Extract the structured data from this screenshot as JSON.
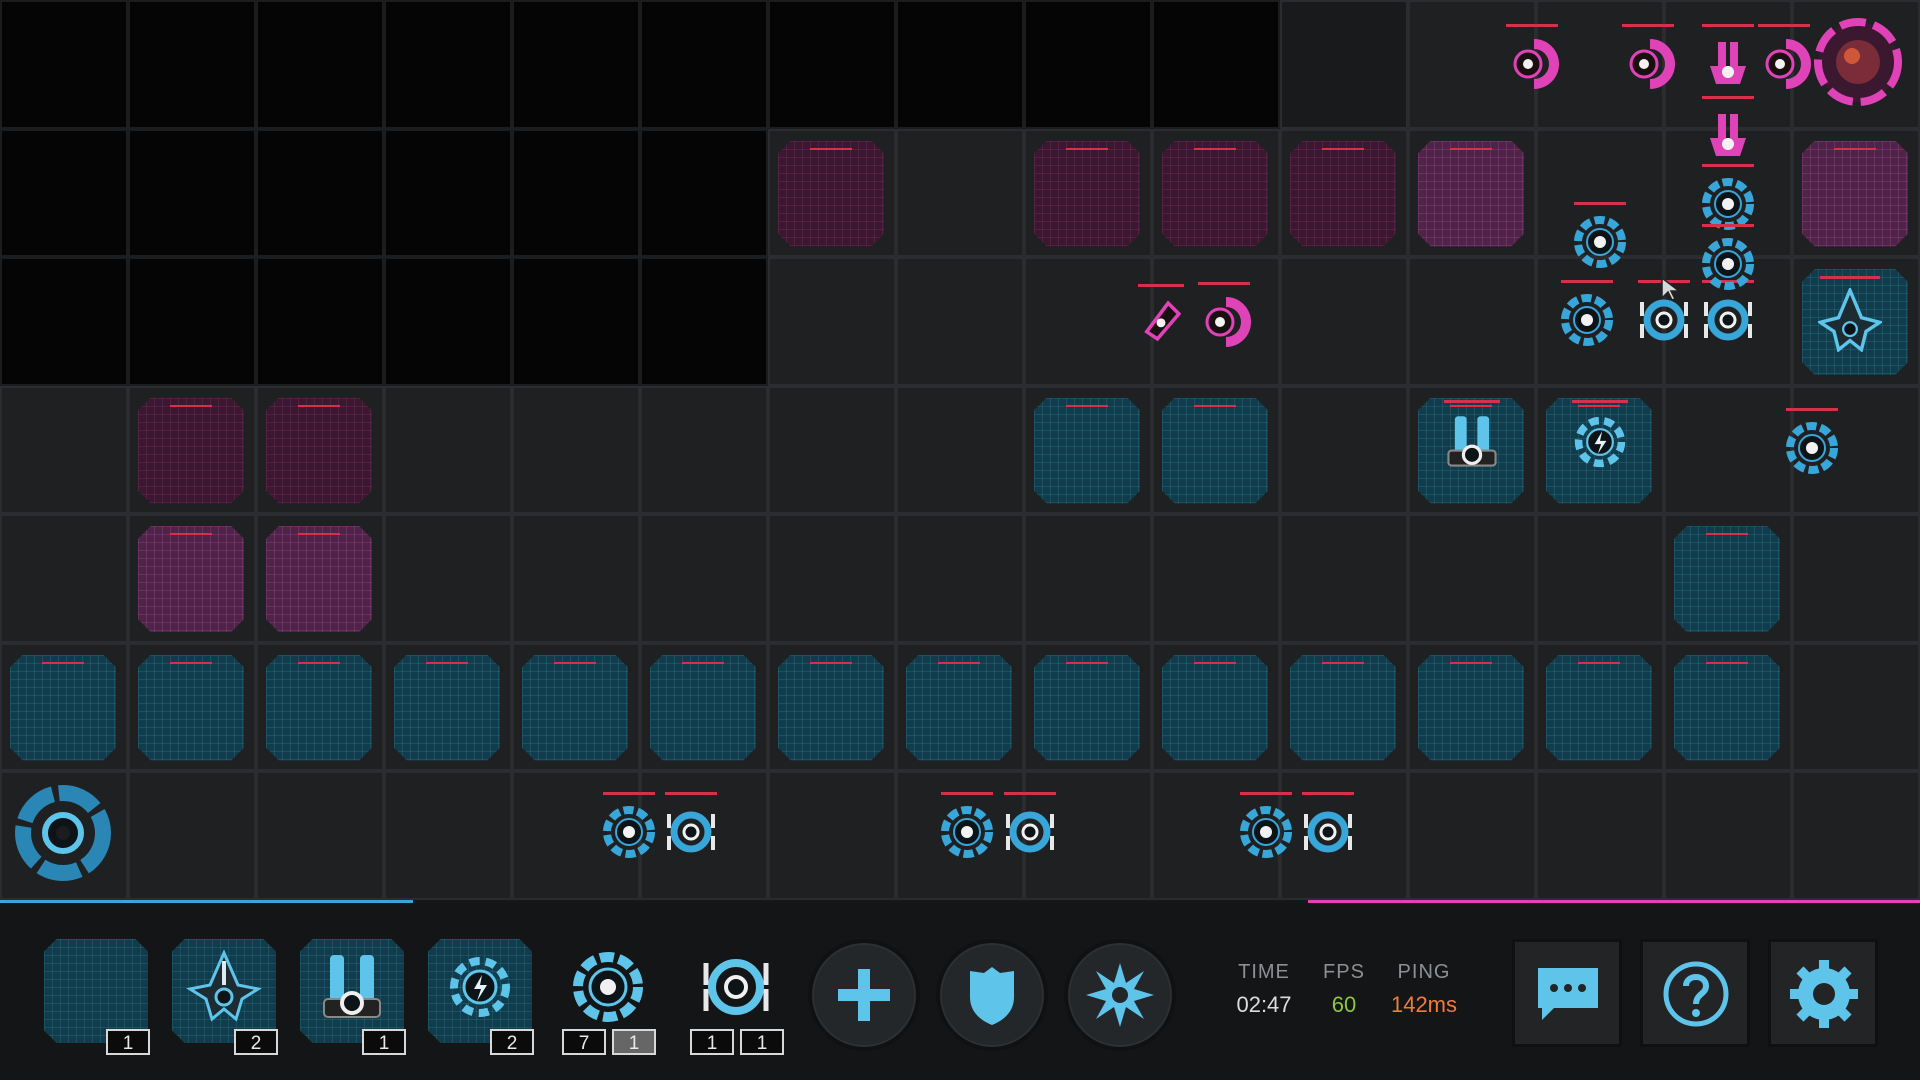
{
  "hud": {
    "inventory": [
      {
        "name": "wall-block",
        "counts": [
          "1"
        ]
      },
      {
        "name": "fighter-ship",
        "counts": [
          "2"
        ]
      },
      {
        "name": "cannon-tower",
        "counts": [
          "1"
        ]
      },
      {
        "name": "shock-generator",
        "counts": [
          "2"
        ]
      },
      {
        "name": "turret-drone",
        "counts": [
          "7",
          "1"
        ]
      },
      {
        "name": "clamp-drone",
        "counts": [
          "1",
          "1"
        ]
      }
    ],
    "abilities": [
      "add-icon",
      "shield-icon",
      "burst-icon"
    ],
    "stats": {
      "time_label": "TIME",
      "time_value": "02:47",
      "fps_label": "FPS",
      "fps_value": "60",
      "ping_label": "PING",
      "ping_value": "142ms"
    },
    "buttons": [
      "chat-icon",
      "help-icon",
      "settings-icon"
    ]
  },
  "colors": {
    "team_blue": "#38a6d8",
    "team_pink": "#e043b8",
    "fps_green": "#8dc63f",
    "ping_orange": "#f07c3c",
    "hp_red": "#d6304a"
  },
  "match": {
    "blue_progress": 0.215,
    "pink_progress": 0.319
  }
}
